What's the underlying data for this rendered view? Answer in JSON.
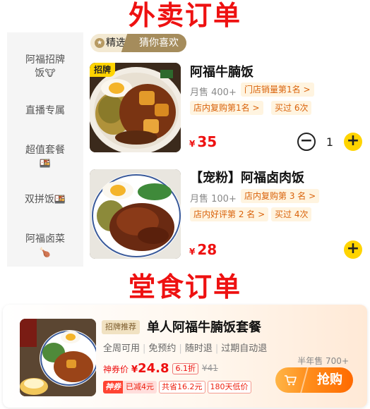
{
  "titles": {
    "delivery": "外卖订单",
    "dine_in": "堂食订单"
  },
  "sidebar": {
    "items": [
      {
        "line1": "阿福招牌",
        "line2": "饭",
        "emoji": "🐮"
      },
      {
        "line1": "直播专属",
        "line2": "",
        "emoji": ""
      },
      {
        "line1": "超值套餐",
        "line2": "",
        "emoji": "🍱"
      },
      {
        "line1": "双拼饭",
        "line2": "",
        "emoji": "🍱"
      },
      {
        "line1": "阿福卤菜",
        "line2": "",
        "emoji": "🍗"
      }
    ]
  },
  "tabs": {
    "selected": "精选",
    "other": "猜你喜欢",
    "star_icon": "crown-icon"
  },
  "items": [
    {
      "badge": "招牌",
      "name": "阿福牛腩饭",
      "sales": "月售 400+",
      "tags": [
        "门店销量第1名 >",
        "店内复购第1名 >",
        "买过 6次"
      ],
      "yen": "¥",
      "price": "35",
      "qty": "1"
    },
    {
      "name": "【宠粉】阿福卤肉饭",
      "sales": "月售 100+",
      "tags": [
        "店内复购第 3 名 >",
        "店内好评第 2 名 >",
        "买过 4次"
      ],
      "yen": "¥",
      "price": "28"
    }
  ],
  "dine": {
    "badge": "招牌推荐",
    "name": "单人阿福牛腩饭套餐",
    "features": [
      "全周可用",
      "免预约",
      "随时退",
      "过期自动退"
    ],
    "half_sales": "半年售 700+",
    "coupon_label": "神券价",
    "yen": "¥",
    "price": "24.8",
    "discount": "6.1折",
    "original": "¥41",
    "shen_label": "神券",
    "shen_reduce": "已减4元",
    "saved": "共省16.2元",
    "low_price": "180天低价",
    "buy_label": "抢购",
    "buy_icon": "cart-icon"
  },
  "colors": {
    "accent_red": "#ee1111",
    "yellow": "#ffd400",
    "tag_orange": "#d9620a",
    "buy_orange": "#ff8c1a"
  }
}
